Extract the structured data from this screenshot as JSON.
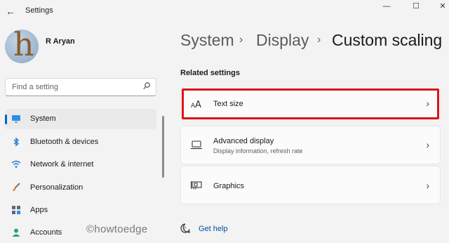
{
  "app": {
    "title": "Settings"
  },
  "user": {
    "name": "R Aryan",
    "avatar_letter": "h"
  },
  "search": {
    "placeholder": "Find a setting"
  },
  "nav": {
    "items": [
      {
        "label": "System",
        "icon": "monitor-icon",
        "active": true
      },
      {
        "label": "Bluetooth & devices",
        "icon": "bluetooth-icon"
      },
      {
        "label": "Network & internet",
        "icon": "wifi-icon"
      },
      {
        "label": "Personalization",
        "icon": "paintbrush-icon"
      },
      {
        "label": "Apps",
        "icon": "apps-icon"
      },
      {
        "label": "Accounts",
        "icon": "account-icon"
      }
    ]
  },
  "breadcrumb": {
    "items": [
      "System",
      "Display"
    ],
    "current": "Custom scaling",
    "separator": "›"
  },
  "related": {
    "title": "Related settings",
    "cards": [
      {
        "label": "Text size",
        "icon": "text-size-icon",
        "highlighted": true
      },
      {
        "label": "Advanced display",
        "sublabel": "Display information, refresh rate",
        "icon": "laptop-icon"
      },
      {
        "label": "Graphics",
        "icon": "graphics-card-icon"
      }
    ]
  },
  "help": {
    "label": "Get help"
  },
  "watermark": "©howtoedge",
  "colors": {
    "accent": "#0067c0",
    "highlight": "#d9151b",
    "background": "#f3f3f3",
    "card": "#fbfbfb"
  }
}
